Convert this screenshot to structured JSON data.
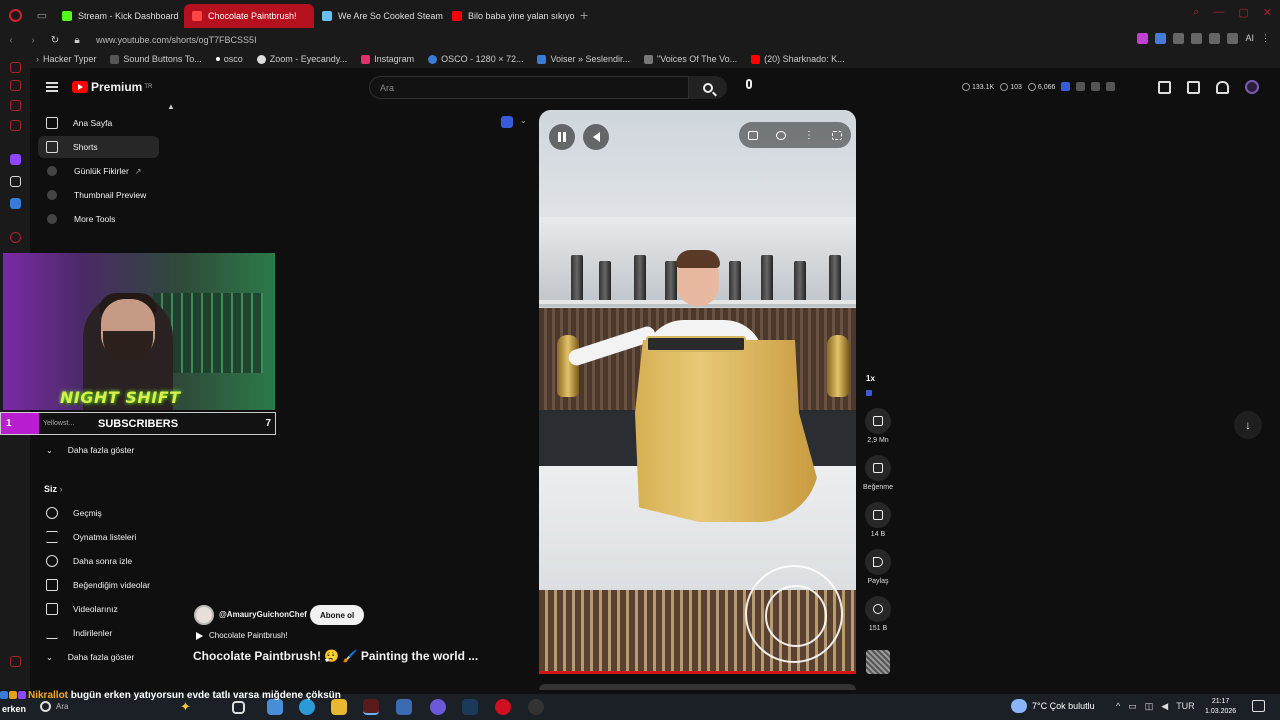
{
  "browser": {
    "tabs": [
      {
        "label": "Stream - Kick Dashboard",
        "color": "#53fc18"
      },
      {
        "label": "Chocolate Paintbrush!",
        "color": "#ff0000",
        "active": true
      },
      {
        "label": "We Are So Cooked Steam",
        "color": "#66c0f4"
      },
      {
        "label": "Bilo baba yine yalan sıkıyo",
        "color": "#ff0000"
      }
    ],
    "url": "www.youtube.com/shorts/ogT7FBCSS5I",
    "extension_label": "AI",
    "bookmarks": [
      {
        "label": "Hacker Typer",
        "color": "#888888"
      },
      {
        "label": "Sound Buttons To...",
        "color": "#555555"
      },
      {
        "label": "osco",
        "color": "#ffffff"
      },
      {
        "label": "Zoom - Eyecandy...",
        "color": "#dddddd"
      },
      {
        "label": "Instagram",
        "color": "#e1306c"
      },
      {
        "label": "OSCO - 1280 × 72...",
        "color": "#3a7bd5"
      },
      {
        "label": "Voiser » Seslendir...",
        "color": "#3a7bd5"
      },
      {
        "label": "\"Voices Of The Vo...",
        "color": "#777777"
      },
      {
        "label": "(20) Sharknado: K...",
        "color": "#ff0000"
      }
    ]
  },
  "youtube": {
    "logo": "Premium",
    "logo_region": "TR",
    "search_placeholder": "Ara",
    "stats": [
      "133.1K",
      "103",
      "6,066"
    ],
    "sidebar": {
      "items": [
        {
          "label": "Ana Sayfa"
        },
        {
          "label": "Shorts",
          "selected": true
        },
        {
          "label": "Günlük Fikirler"
        },
        {
          "label": "Thumbnail Preview"
        },
        {
          "label": "More Tools"
        }
      ],
      "more_label": "Daha fazla göster",
      "you_label": "Siz",
      "you_items": [
        {
          "label": "Geçmiş"
        },
        {
          "label": "Oynatma listeleri"
        },
        {
          "label": "Daha sonra izle"
        },
        {
          "label": "Beğendiğim videolar"
        },
        {
          "label": "Videolarınız"
        },
        {
          "label": "İndirilenler"
        }
      ],
      "more_label_2": "Daha fazla göster",
      "partial_item": "Yellowst..."
    },
    "overlay": {
      "title": "NIGHT SHIFT",
      "subscribers_label": "SUBSCRIBERS",
      "left_count": "1",
      "right_count": "7"
    },
    "short": {
      "speed": "1x",
      "likes": "2,9 Mn",
      "dislike_label": "Beğenme",
      "comments": "14 B",
      "share_label": "Paylaş",
      "remix": "151 B",
      "channel": "@AmauryGuichonChef",
      "subscribe_label": "Abone ol",
      "sound": "Chocolate Paintbrush!",
      "title": "Chocolate Paintbrush! 😮‍💨 🖌️ Painting the world ..."
    }
  },
  "chat": {
    "user": "Nikrallot",
    "message": "bugün erken yatıyorsun evde tatlı varsa miğdene çöksün"
  },
  "taskbar": {
    "streamer_name": "erken",
    "search_label": "Ara",
    "weather": "7°C  Çok bulutlu",
    "lang": "TUR",
    "time": "21:17",
    "date": "1.03.2026"
  }
}
